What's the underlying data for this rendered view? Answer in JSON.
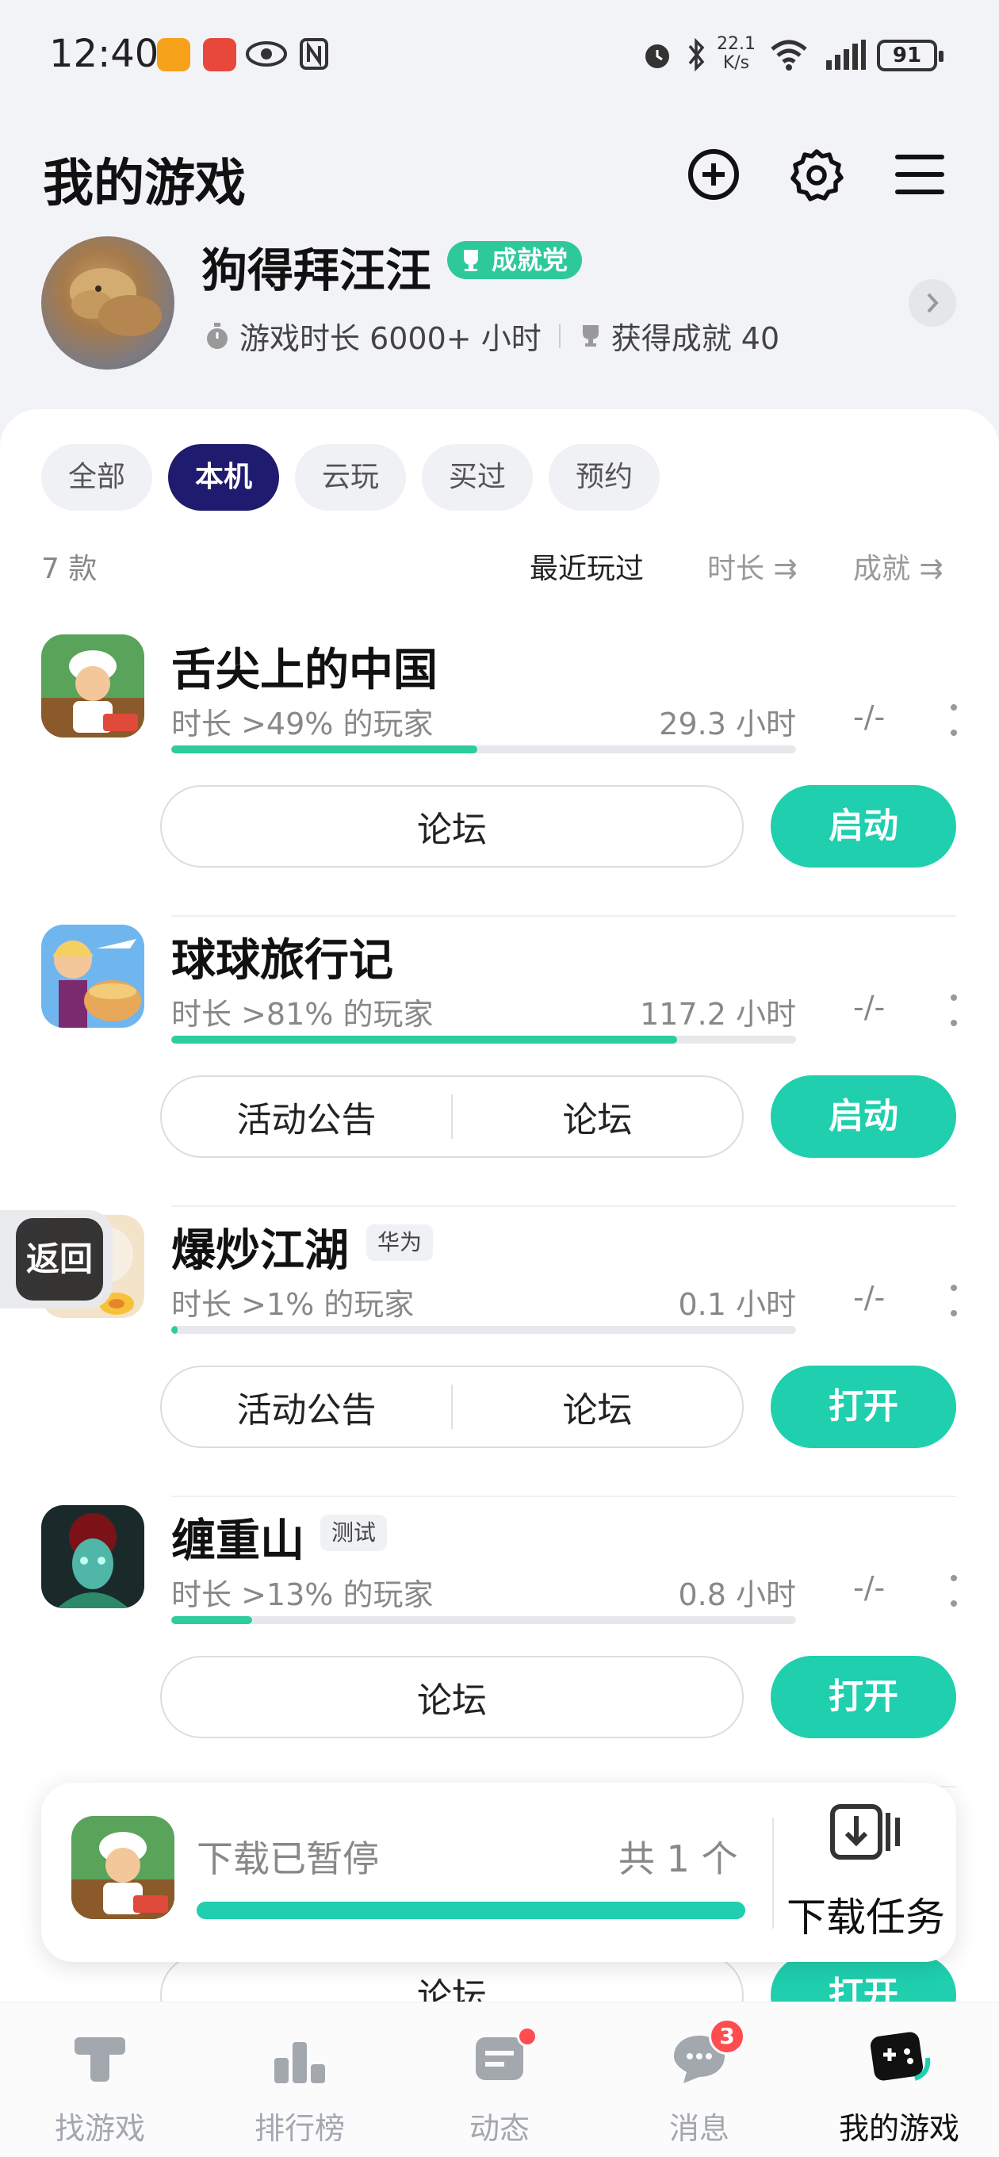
{
  "status_bar": {
    "time": "12:40",
    "speed_value": "22.1",
    "speed_unit": "K/s",
    "battery": "91",
    "icons": [
      "app-orange-icon",
      "app-red-icon",
      "eye-icon",
      "nfc-icon",
      "alarm-icon",
      "bluetooth-icon",
      "wifi-icon",
      "signal-icon",
      "battery-icon"
    ]
  },
  "header": {
    "title": "我的游戏",
    "icons": [
      "add-icon",
      "settings-icon",
      "menu-icon"
    ]
  },
  "profile": {
    "name": "狗得拜汪汪",
    "badge": "成就党",
    "playtime": "游戏时长 6000+ 小时",
    "achievements": "获得成就 40"
  },
  "tabs": [
    {
      "label": "全部",
      "active": false
    },
    {
      "label": "本机",
      "active": true
    },
    {
      "label": "云玩",
      "active": false
    },
    {
      "label": "买过",
      "active": false
    },
    {
      "label": "预约",
      "active": false
    }
  ],
  "list": {
    "count": "7 款",
    "sort_recent": "最近玩过",
    "sort_duration": "时长 ⇉",
    "sort_achievement": "成就 ⇉"
  },
  "games": [
    {
      "name": "舌尖上的中国",
      "tag": "",
      "subtitle": "时长 >49% 的玩家",
      "hours": "29.3 小时",
      "achievement": "-/-",
      "progress": 0.49,
      "buttons": [
        "论坛"
      ],
      "action": "启动"
    },
    {
      "name": "球球旅行记",
      "tag": "",
      "subtitle": "时长 >81% 的玩家",
      "hours": "117.2 小时",
      "achievement": "-/-",
      "progress": 0.81,
      "buttons": [
        "活动公告",
        "论坛"
      ],
      "action": "启动"
    },
    {
      "name": "爆炒江湖",
      "tag": "华为",
      "subtitle": "时长 >1% 的玩家",
      "hours": "0.1 小时",
      "achievement": "-/-",
      "progress": 0.01,
      "buttons": [
        "活动公告",
        "论坛"
      ],
      "action": "打开"
    },
    {
      "name": "缠重山",
      "tag": "测试",
      "subtitle": "时长 >13% 的玩家",
      "hours": "0.8 小时",
      "achievement": "-/-",
      "progress": 0.13,
      "buttons": [
        "论坛"
      ],
      "action": "打开"
    }
  ],
  "partial_row": {
    "button": "论坛",
    "action": "打开"
  },
  "back_float": "返回",
  "download": {
    "status": "下载已暂停",
    "count": "共 1 个",
    "progress": 1.0,
    "task_label": "下载任务"
  },
  "bottom_nav": [
    {
      "label": "找游戏",
      "icon": "find-game-icon",
      "active": false
    },
    {
      "label": "排行榜",
      "icon": "leaderboard-icon",
      "active": false
    },
    {
      "label": "动态",
      "icon": "feed-icon",
      "active": false,
      "dot": true
    },
    {
      "label": "消息",
      "icon": "message-icon",
      "active": false,
      "badge": "3"
    },
    {
      "label": "我的游戏",
      "icon": "my-games-icon",
      "active": true
    }
  ],
  "colors": {
    "accent": "#1fcfae",
    "tab_active": "#1f1b6e",
    "badge_green": "#2dc99a",
    "notify_red": "#ff4d4f"
  }
}
